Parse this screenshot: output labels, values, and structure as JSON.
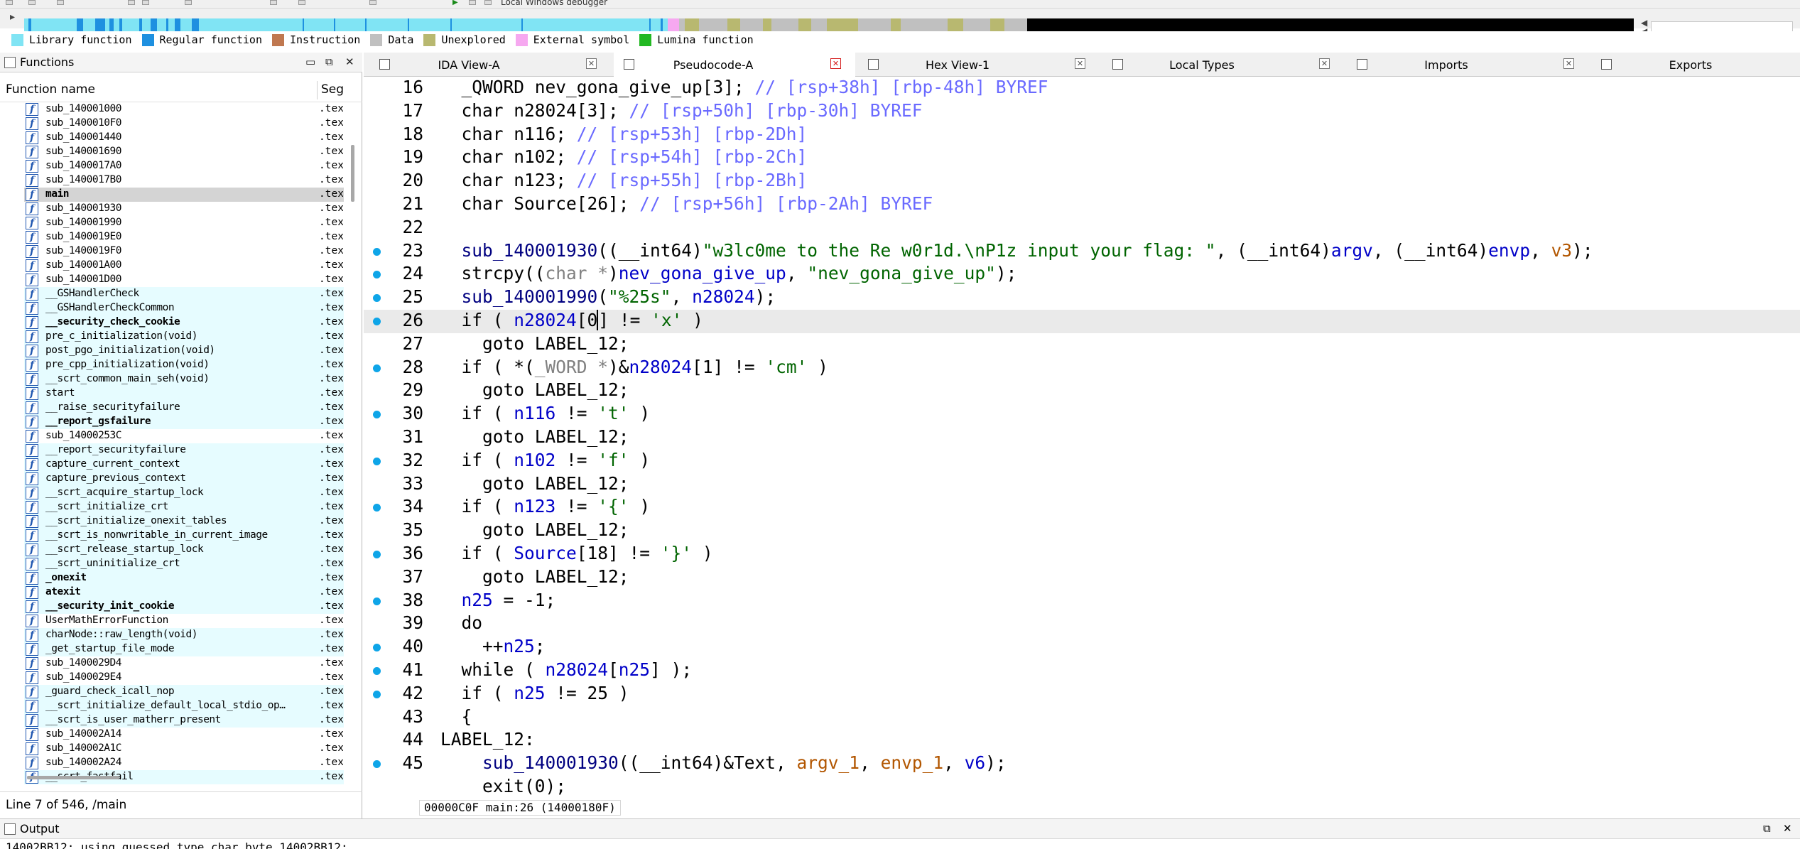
{
  "toolbar": {
    "debugger_label": "Local Windows debugger"
  },
  "legend": [
    {
      "label": "Library function",
      "color": "#80e4f4"
    },
    {
      "label": "Regular function",
      "color": "#1e90e0"
    },
    {
      "label": "Instruction",
      "color": "#c07850"
    },
    {
      "label": "Data",
      "color": "#c0c0c0"
    },
    {
      "label": "Unexplored",
      "color": "#b8b870"
    },
    {
      "label": "External symbol",
      "color": "#f6a8f0"
    },
    {
      "label": "Lumina function",
      "color": "#22b822"
    }
  ],
  "functions_panel": {
    "title": "Functions",
    "col_name": "Function name",
    "col_seg": "Seg",
    "status": "Line 7 of 546, /main",
    "items": [
      {
        "name": "sub_140001000",
        "seg": ".tex",
        "lib": false,
        "bold": false
      },
      {
        "name": "sub_1400010F0",
        "seg": ".tex",
        "lib": false,
        "bold": false
      },
      {
        "name": "sub_140001440",
        "seg": ".tex",
        "lib": false,
        "bold": false
      },
      {
        "name": "sub_140001690",
        "seg": ".tex",
        "lib": false,
        "bold": false
      },
      {
        "name": "sub_1400017A0",
        "seg": ".tex",
        "lib": false,
        "bold": false
      },
      {
        "name": "sub_1400017B0",
        "seg": ".tex",
        "lib": false,
        "bold": false
      },
      {
        "name": "main",
        "seg": ".tex",
        "lib": false,
        "bold": true,
        "selected": true
      },
      {
        "name": "sub_140001930",
        "seg": ".tex",
        "lib": false,
        "bold": false
      },
      {
        "name": "sub_140001990",
        "seg": ".tex",
        "lib": false,
        "bold": false
      },
      {
        "name": "sub_1400019E0",
        "seg": ".tex",
        "lib": false,
        "bold": false
      },
      {
        "name": "sub_1400019F0",
        "seg": ".tex",
        "lib": false,
        "bold": false
      },
      {
        "name": "sub_140001A00",
        "seg": ".tex",
        "lib": false,
        "bold": false
      },
      {
        "name": "sub_140001D00",
        "seg": ".tex",
        "lib": false,
        "bold": false
      },
      {
        "name": "__GSHandlerCheck",
        "seg": ".tex",
        "lib": true,
        "bold": false
      },
      {
        "name": "__GSHandlerCheckCommon",
        "seg": ".tex",
        "lib": true,
        "bold": false
      },
      {
        "name": "__security_check_cookie",
        "seg": ".tex",
        "lib": true,
        "bold": true
      },
      {
        "name": "pre_c_initialization(void)",
        "seg": ".tex",
        "lib": true,
        "bold": false
      },
      {
        "name": "post_pgo_initialization(void)",
        "seg": ".tex",
        "lib": true,
        "bold": false
      },
      {
        "name": "pre_cpp_initialization(void)",
        "seg": ".tex",
        "lib": true,
        "bold": false
      },
      {
        "name": "__scrt_common_main_seh(void)",
        "seg": ".tex",
        "lib": true,
        "bold": false
      },
      {
        "name": "start",
        "seg": ".tex",
        "lib": true,
        "bold": false
      },
      {
        "name": "__raise_securityfailure",
        "seg": ".tex",
        "lib": true,
        "bold": false
      },
      {
        "name": "__report_gsfailure",
        "seg": ".tex",
        "lib": true,
        "bold": true
      },
      {
        "name": "sub_14000253C",
        "seg": ".tex",
        "lib": false,
        "bold": false
      },
      {
        "name": "__report_securityfailure",
        "seg": ".tex",
        "lib": true,
        "bold": false
      },
      {
        "name": "capture_current_context",
        "seg": ".tex",
        "lib": true,
        "bold": false
      },
      {
        "name": "capture_previous_context",
        "seg": ".tex",
        "lib": true,
        "bold": false
      },
      {
        "name": "__scrt_acquire_startup_lock",
        "seg": ".tex",
        "lib": true,
        "bold": false
      },
      {
        "name": "__scrt_initialize_crt",
        "seg": ".tex",
        "lib": true,
        "bold": false
      },
      {
        "name": "__scrt_initialize_onexit_tables",
        "seg": ".tex",
        "lib": true,
        "bold": false
      },
      {
        "name": "__scrt_is_nonwritable_in_current_image",
        "seg": ".tex",
        "lib": true,
        "bold": false
      },
      {
        "name": "__scrt_release_startup_lock",
        "seg": ".tex",
        "lib": true,
        "bold": false
      },
      {
        "name": "__scrt_uninitialize_crt",
        "seg": ".tex",
        "lib": true,
        "bold": false
      },
      {
        "name": "_onexit",
        "seg": ".tex",
        "lib": true,
        "bold": true
      },
      {
        "name": "atexit",
        "seg": ".tex",
        "lib": true,
        "bold": true
      },
      {
        "name": "__security_init_cookie",
        "seg": ".tex",
        "lib": true,
        "bold": true
      },
      {
        "name": "UserMathErrorFunction",
        "seg": ".tex",
        "lib": false,
        "bold": false
      },
      {
        "name": "charNode::raw_length(void)",
        "seg": ".tex",
        "lib": true,
        "bold": false
      },
      {
        "name": "_get_startup_file_mode",
        "seg": ".tex",
        "lib": true,
        "bold": false
      },
      {
        "name": "sub_1400029D4",
        "seg": ".tex",
        "lib": false,
        "bold": false
      },
      {
        "name": "sub_1400029E4",
        "seg": ".tex",
        "lib": false,
        "bold": false
      },
      {
        "name": "_guard_check_icall_nop",
        "seg": ".tex",
        "lib": true,
        "bold": false
      },
      {
        "name": "__scrt_initialize_default_local_stdio_op…",
        "seg": ".tex",
        "lib": true,
        "bold": false
      },
      {
        "name": "__scrt_is_user_matherr_present",
        "seg": ".tex",
        "lib": true,
        "bold": false
      },
      {
        "name": "sub_140002A14",
        "seg": ".tex",
        "lib": false,
        "bold": false
      },
      {
        "name": "sub_140002A1C",
        "seg": ".tex",
        "lib": false,
        "bold": false
      },
      {
        "name": "sub_140002A24",
        "seg": ".tex",
        "lib": false,
        "bold": false
      },
      {
        "name": "__scrt_fastfail",
        "seg": ".tex",
        "lib": true,
        "bold": false
      }
    ]
  },
  "tabs": [
    {
      "label": "IDA View-A",
      "icon": "ida-view-icon",
      "active": false
    },
    {
      "label": "Pseudocode-A",
      "icon": "pseudocode-icon",
      "active": true
    },
    {
      "label": "Hex View-1",
      "icon": "hex-view-icon",
      "active": false
    },
    {
      "label": "Local Types",
      "icon": "local-types-icon",
      "active": false
    },
    {
      "label": "Imports",
      "icon": "imports-icon",
      "active": false
    },
    {
      "label": "Exports",
      "icon": "exports-icon",
      "active": false
    }
  ],
  "code": {
    "current_line": 26,
    "lines": [
      {
        "n": "16",
        "bp": false,
        "segs": [
          [
            "",
            "  _QWORD nev_gona_give_up[3]; "
          ],
          [
            "c",
            "// [rsp+38h] [rbp-48h] BYREF"
          ]
        ]
      },
      {
        "n": "17",
        "bp": false,
        "segs": [
          [
            "",
            "  char n28024[3]; "
          ],
          [
            "c",
            "// [rsp+50h] [rbp-30h] BYREF"
          ]
        ]
      },
      {
        "n": "18",
        "bp": false,
        "segs": [
          [
            "",
            "  char n116; "
          ],
          [
            "c",
            "// [rsp+53h] [rbp-2Dh]"
          ]
        ]
      },
      {
        "n": "19",
        "bp": false,
        "segs": [
          [
            "",
            "  char n102; "
          ],
          [
            "c",
            "// [rsp+54h] [rbp-2Ch]"
          ]
        ]
      },
      {
        "n": "20",
        "bp": false,
        "segs": [
          [
            "",
            "  char n123; "
          ],
          [
            "c",
            "// [rsp+55h] [rbp-2Bh]"
          ]
        ]
      },
      {
        "n": "21",
        "bp": false,
        "segs": [
          [
            "",
            "  char Source[26]; "
          ],
          [
            "c",
            "// [rsp+56h] [rbp-2Ah] BYREF"
          ]
        ]
      },
      {
        "n": "22",
        "bp": false,
        "segs": []
      },
      {
        "n": "23",
        "bp": true,
        "segs": [
          [
            "",
            "  "
          ],
          [
            "k",
            "sub_140001930"
          ],
          [
            "",
            "((__int64)"
          ],
          [
            "s",
            "\"w3lc0me to the Re w0r1d.\\nP1z input your flag: \""
          ],
          [
            "",
            ", (__int64)"
          ],
          [
            "v",
            "argv"
          ],
          [
            "",
            ", (__int64)"
          ],
          [
            "v",
            "envp"
          ],
          [
            "",
            ", "
          ],
          [
            "a",
            "v3"
          ],
          [
            "",
            ");"
          ]
        ]
      },
      {
        "n": "24",
        "bp": true,
        "segs": [
          [
            "",
            "  strcpy(("
          ],
          [
            "t",
            "char *"
          ],
          [
            "",
            ")"
          ],
          [
            "v",
            "nev_gona_give_up"
          ],
          [
            "",
            ", "
          ],
          [
            "s",
            "\"nev_gona_give_up\""
          ],
          [
            "",
            ");"
          ]
        ]
      },
      {
        "n": "25",
        "bp": true,
        "segs": [
          [
            "",
            "  "
          ],
          [
            "k",
            "sub_140001990"
          ],
          [
            "",
            "("
          ],
          [
            "s",
            "\"%25s\""
          ],
          [
            "",
            ", "
          ],
          [
            "v",
            "n28024"
          ],
          [
            "",
            ");"
          ]
        ]
      },
      {
        "n": "26",
        "bp": true,
        "segs": [
          [
            "",
            "  if ( "
          ],
          [
            "v",
            "n28024"
          ],
          [
            "",
            "[0"
          ],
          [
            "caret",
            "]"
          ],
          [
            "",
            " != "
          ],
          [
            "s",
            "'x'"
          ],
          [
            "",
            " )"
          ]
        ]
      },
      {
        "n": "27",
        "bp": false,
        "segs": [
          [
            "",
            "    goto LABEL_12;"
          ]
        ]
      },
      {
        "n": "28",
        "bp": true,
        "segs": [
          [
            "",
            "  if ( *("
          ],
          [
            "t",
            "_WORD *"
          ],
          [
            "",
            ")&"
          ],
          [
            "v",
            "n28024"
          ],
          [
            "",
            "[1] != "
          ],
          [
            "s",
            "'cm'"
          ],
          [
            "",
            " )"
          ]
        ]
      },
      {
        "n": "29",
        "bp": false,
        "segs": [
          [
            "",
            "    goto LABEL_12;"
          ]
        ]
      },
      {
        "n": "30",
        "bp": true,
        "segs": [
          [
            "",
            "  if ( "
          ],
          [
            "v",
            "n116"
          ],
          [
            "",
            " != "
          ],
          [
            "s",
            "'t'"
          ],
          [
            "",
            " )"
          ]
        ]
      },
      {
        "n": "31",
        "bp": false,
        "segs": [
          [
            "",
            "    goto LABEL_12;"
          ]
        ]
      },
      {
        "n": "32",
        "bp": true,
        "segs": [
          [
            "",
            "  if ( "
          ],
          [
            "v",
            "n102"
          ],
          [
            "",
            " != "
          ],
          [
            "s",
            "'f'"
          ],
          [
            "",
            " )"
          ]
        ]
      },
      {
        "n": "33",
        "bp": false,
        "segs": [
          [
            "",
            "    goto LABEL_12;"
          ]
        ]
      },
      {
        "n": "34",
        "bp": true,
        "segs": [
          [
            "",
            "  if ( "
          ],
          [
            "v",
            "n123"
          ],
          [
            "",
            " != "
          ],
          [
            "s",
            "'{'"
          ],
          [
            "",
            " )"
          ]
        ]
      },
      {
        "n": "35",
        "bp": false,
        "segs": [
          [
            "",
            "    goto LABEL_12;"
          ]
        ]
      },
      {
        "n": "36",
        "bp": true,
        "segs": [
          [
            "",
            "  if ( "
          ],
          [
            "v",
            "Source"
          ],
          [
            "",
            "[18] != "
          ],
          [
            "s",
            "'}'"
          ],
          [
            "",
            " )"
          ]
        ]
      },
      {
        "n": "37",
        "bp": false,
        "segs": [
          [
            "",
            "    goto LABEL_12;"
          ]
        ]
      },
      {
        "n": "38",
        "bp": true,
        "segs": [
          [
            "",
            "  "
          ],
          [
            "v",
            "n25"
          ],
          [
            "",
            " = -1;"
          ]
        ]
      },
      {
        "n": "39",
        "bp": false,
        "segs": [
          [
            "",
            "  do"
          ]
        ]
      },
      {
        "n": "40",
        "bp": true,
        "segs": [
          [
            "",
            "    ++"
          ],
          [
            "v",
            "n25"
          ],
          [
            "",
            ";"
          ]
        ]
      },
      {
        "n": "41",
        "bp": true,
        "segs": [
          [
            "",
            "  while ( "
          ],
          [
            "v",
            "n28024"
          ],
          [
            "",
            "["
          ],
          [
            "v",
            "n25"
          ],
          [
            "",
            "] );"
          ]
        ]
      },
      {
        "n": "42",
        "bp": true,
        "segs": [
          [
            "",
            "  if ( "
          ],
          [
            "v",
            "n25"
          ],
          [
            "",
            " != 25 )"
          ]
        ]
      },
      {
        "n": "43",
        "bp": false,
        "segs": [
          [
            "",
            "  {"
          ]
        ]
      },
      {
        "n": "44",
        "bp": false,
        "segs": [
          [
            "",
            "LABEL_12:"
          ]
        ]
      },
      {
        "n": "45",
        "bp": true,
        "segs": [
          [
            "",
            "    "
          ],
          [
            "k",
            "sub_140001930"
          ],
          [
            "",
            "((__int64)&Text, "
          ],
          [
            "a",
            "argv_1"
          ],
          [
            "",
            ", "
          ],
          [
            "a",
            "envp_1"
          ],
          [
            "",
            ", "
          ],
          [
            "v",
            "v6"
          ],
          [
            "",
            ");"
          ]
        ]
      },
      {
        "n": "",
        "bp": false,
        "segs": [
          [
            "",
            "    exit(0);"
          ]
        ]
      }
    ]
  },
  "code_status": "00000C0F main:26 (14000180F)",
  "output": {
    "title": "Output",
    "text": "14002BB12: using guessed type char byte_14002BB12;"
  }
}
